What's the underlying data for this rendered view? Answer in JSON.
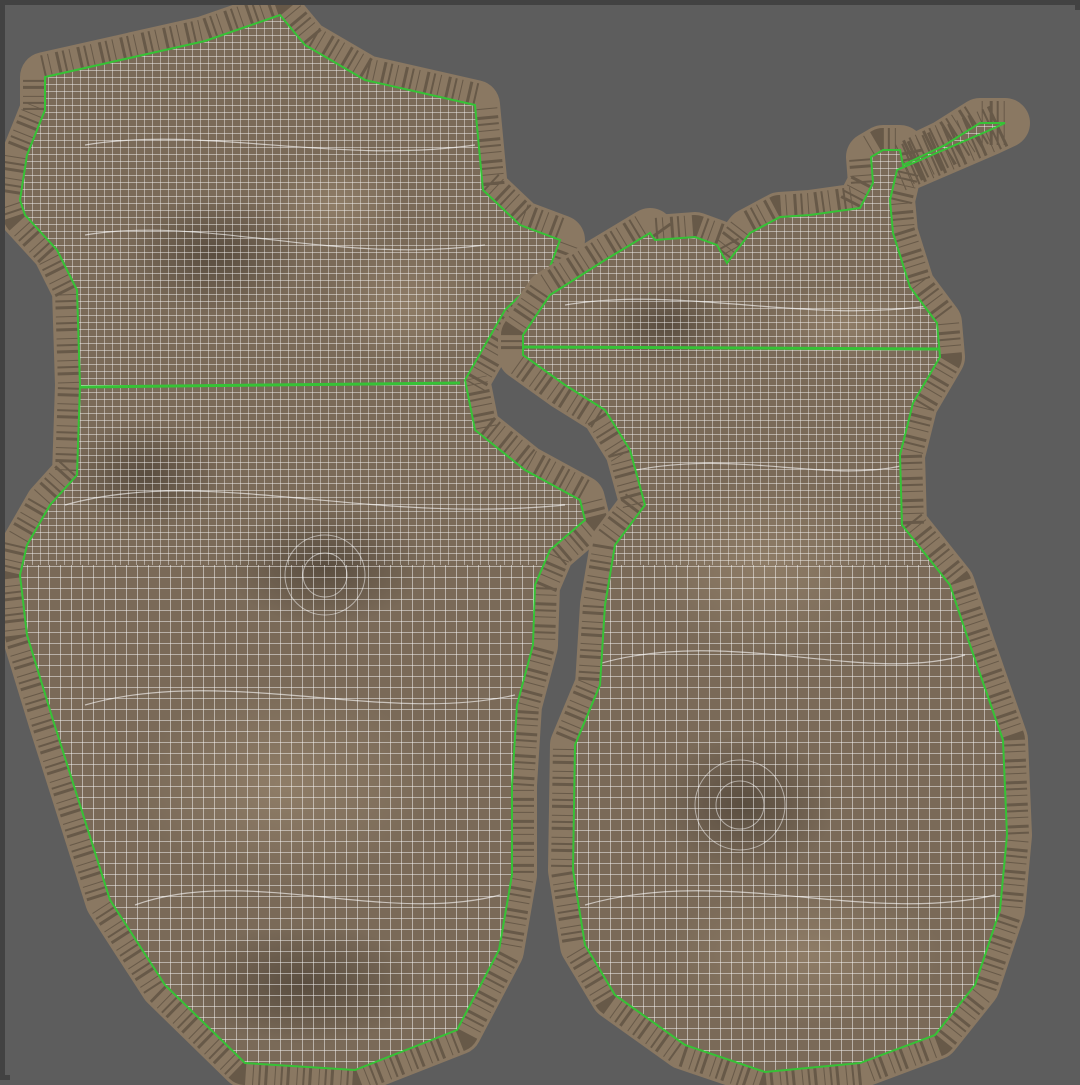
{
  "viewport": {
    "background_color": "#5d5d5d",
    "frame_color": "#424242"
  },
  "islands": [
    {
      "id": "island-left",
      "seam_count": 1
    },
    {
      "id": "island-right",
      "seam_count": 1,
      "has_handle": true
    }
  ],
  "colors": {
    "texture_base": "#7a6a58",
    "texture_light": "#8d7b66",
    "texture_dark": "#5e5143",
    "wire": "#ffffff",
    "seam": "#36c236",
    "padding_light": "#a2927a",
    "padding_dark": "#3a3128"
  }
}
